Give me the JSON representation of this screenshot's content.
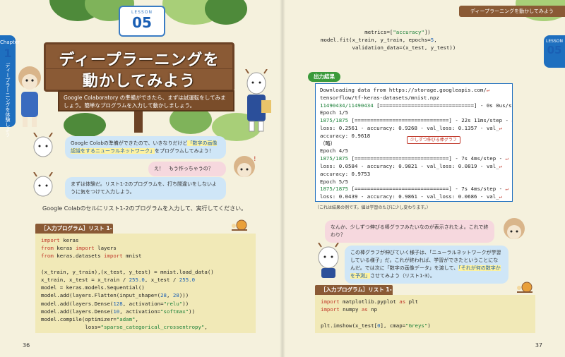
{
  "left": {
    "chapter_label": "Chapter",
    "chapter_number": "1",
    "chapter_vertical": "ディープラーニングを体験しよう",
    "lesson_label": "LESSON",
    "lesson_number": "05",
    "title_line1": "ディープラーニングを",
    "title_line2": "動かしてみよう",
    "intro": "Google Colaboratory の準備ができたら、まずは試運転をしてみましょう。簡単なプログラムを入力して動かしましょう。",
    "bubble1_pre": "Google Colabの準備ができたので、いきなりだけど",
    "bubble1_hl": "「数字の画像認識をするニューラルネットワーク」",
    "bubble1_post": "をプログラムしてみよう！",
    "bubble2": "え！　もう作っちゃうの？",
    "bubble3": "まずは体験だ。リスト1-2のプログラムを、打ち間違いをしないように気をつけて入力しよう。",
    "instruction": "Google Colabのセルにリスト1-2のプログラムを入力して、実行してください。",
    "listing_title": "［入力プログラム］リスト 1-2",
    "page_number": "36"
  },
  "code_1_2": [
    [
      {
        "t": "import",
        "c": "kw"
      },
      {
        "t": " keras"
      }
    ],
    [
      {
        "t": "from",
        "c": "kw"
      },
      {
        "t": " keras "
      },
      {
        "t": "import",
        "c": "kw"
      },
      {
        "t": " layers"
      }
    ],
    [
      {
        "t": "from",
        "c": "kw"
      },
      {
        "t": " keras.datasets "
      },
      {
        "t": "import",
        "c": "kw"
      },
      {
        "t": " mnist"
      }
    ],
    [
      {
        "t": ""
      }
    ],
    [
      {
        "t": "(x_train, y_train),(x_test, y_test) = mnist.load_data()"
      }
    ],
    [
      {
        "t": "x_train, x_test = x_train / "
      },
      {
        "t": "255.0",
        "c": "num"
      },
      {
        "t": ", x_test / "
      },
      {
        "t": "255.0",
        "c": "num"
      }
    ],
    [
      {
        "t": "model = keras.models.Sequential()"
      }
    ],
    [
      {
        "t": "model.add(layers.Flatten(input_shape=("
      },
      {
        "t": "28",
        "c": "num"
      },
      {
        "t": ", "
      },
      {
        "t": "28",
        "c": "num"
      },
      {
        "t": ")))"
      }
    ],
    [
      {
        "t": "model.add(layers.Dense("
      },
      {
        "t": "128",
        "c": "num"
      },
      {
        "t": ", activation="
      },
      {
        "t": "\"relu\"",
        "c": "str"
      },
      {
        "t": "))"
      }
    ],
    [
      {
        "t": "model.add(layers.Dense("
      },
      {
        "t": "10",
        "c": "num"
      },
      {
        "t": ", activation="
      },
      {
        "t": "\"softmax\"",
        "c": "str"
      },
      {
        "t": "))"
      }
    ],
    [
      {
        "t": "model.compile(optimizer="
      },
      {
        "t": "\"adam\"",
        "c": "str"
      },
      {
        "t": ","
      }
    ],
    [
      {
        "t": "              loss="
      },
      {
        "t": "\"sparse_categorical_crossentropy\"",
        "c": "str"
      },
      {
        "t": ","
      }
    ]
  ],
  "right": {
    "header": "ディープラーニングを動かしてみよう",
    "lesson_label": "LESSON",
    "lesson_number": "05",
    "output_label": "出力結果",
    "callout": "少しずつ伸びる棒グラフ",
    "note": "（これは結果の例です。値は学習のたびに少し変わります。）",
    "bubble4": "なんか、少しずつ伸びる棒グラフみたいなのが表示されたよ。これで終わり？",
    "bubble5_pre": "この棒グラフが伸びていく様子は、「ニューラルネットワークが学習している様子」だ。これが終われば、学習ができたということになんだ。では次に「数字の画像データ」を渡して、",
    "bubble5_hl": "「それが何の数字かを予測」",
    "bubble5_post": "させてみよう（リスト1-3）。",
    "listing_title": "［入力プログラム］リスト 1-3",
    "page_number": "37"
  },
  "code_cont": [
    [
      {
        "t": "              metrics=["
      },
      {
        "t": "\"accuracy\"",
        "c": "str"
      },
      {
        "t": "])"
      }
    ],
    [
      {
        "t": "model.fit(x_train, y_train, epochs="
      },
      {
        "t": "5",
        "c": "num"
      },
      {
        "t": ","
      }
    ],
    [
      {
        "t": "          validation_data=(x_test, y_test))"
      }
    ]
  ],
  "output_lines": [
    [
      {
        "t": "Downloading data from https://storage.googleapis.com/"
      },
      {
        "t": "↵",
        "c": "ret"
      }
    ],
    [
      {
        "t": "tensorflow/tf-keras-datasets/mnist.npz"
      }
    ],
    [
      {
        "t": "11490434/11490434",
        "c": "grn"
      },
      {
        "t": " [==============================] - 0s 0us/step"
      }
    ],
    [
      {
        "t": "Epoch 1/5"
      }
    ],
    [
      {
        "t": "1875/1875",
        "c": "grn"
      },
      {
        "t": " [==============================] - 22s 11ms/step - "
      },
      {
        "t": "↵",
        "c": "ret"
      }
    ],
    [
      {
        "t": "loss: 0.2561 - accuracy: 0.9268 - val_loss: 0.1357 - val_"
      },
      {
        "t": "↵",
        "c": "ret"
      }
    ],
    [
      {
        "t": "accuracy: 0.9618"
      }
    ],
    [
      {
        "t": "（略）"
      }
    ],
    [
      {
        "t": "Epoch 4/5"
      }
    ],
    [
      {
        "t": "1875/1875",
        "c": "grn"
      },
      {
        "t": " [==============================] - 7s 4ms/step - "
      },
      {
        "t": "↵",
        "c": "ret"
      }
    ],
    [
      {
        "t": "loss: 0.0584 - accuracy: 0.9821 - val_loss: 0.0819 - val_"
      },
      {
        "t": "↵",
        "c": "ret"
      }
    ],
    [
      {
        "t": "accuracy: 0.9753"
      }
    ],
    [
      {
        "t": "Epoch 5/5"
      }
    ],
    [
      {
        "t": "1875/1875",
        "c": "grn"
      },
      {
        "t": " [==============================] - 7s 4ms/step - "
      },
      {
        "t": "↵",
        "c": "ret"
      }
    ],
    [
      {
        "t": "loss: 0.0439 - accuracy: 0.9861 - val_loss: 0.0686 - val_"
      },
      {
        "t": "↵",
        "c": "ret"
      }
    ],
    [
      {
        "t": "accuracy: 0.9778"
      }
    ],
    [
      {
        "t": "<keras.callbacks.History at 0x7f776b975460>"
      }
    ]
  ],
  "code_1_3": [
    [
      {
        "t": "import",
        "c": "kw"
      },
      {
        "t": " matplotlib.pyplot "
      },
      {
        "t": "as",
        "c": "kw"
      },
      {
        "t": " plt"
      }
    ],
    [
      {
        "t": "import",
        "c": "kw"
      },
      {
        "t": " numpy "
      },
      {
        "t": "as",
        "c": "kw"
      },
      {
        "t": " np"
      }
    ],
    [
      {
        "t": ""
      }
    ],
    [
      {
        "t": "plt.imshow(x_test["
      },
      {
        "t": "0",
        "c": "num"
      },
      {
        "t": "], cmap="
      },
      {
        "t": "\"Greys\"",
        "c": "str"
      },
      {
        "t": ")"
      }
    ]
  ],
  "colors": {
    "accent_blue": "#1e6fbf",
    "wood": "#8a5a35",
    "code_bg": "#f1e9b7",
    "output_green": "#3a9a3a"
  }
}
